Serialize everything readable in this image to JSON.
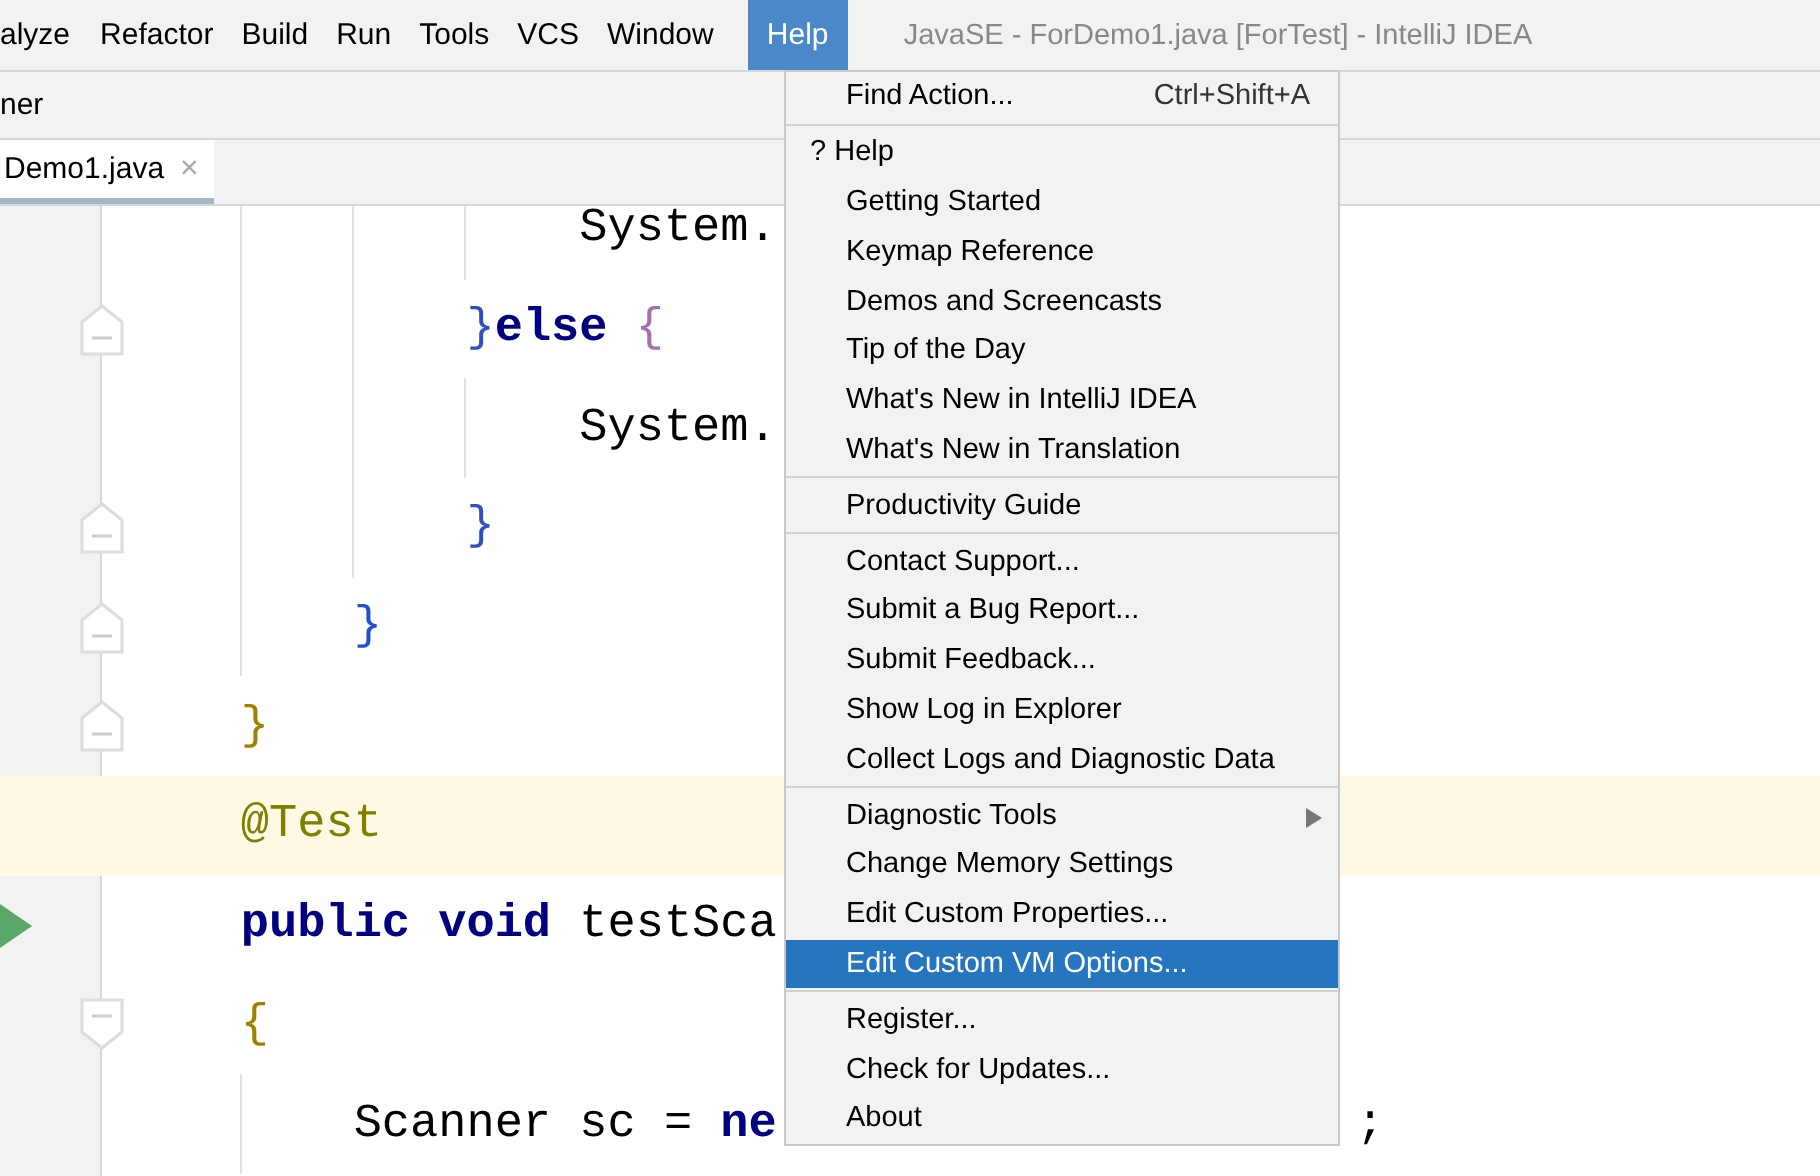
{
  "menu_bar": [
    {
      "label": "alyze",
      "selected": false
    },
    {
      "label": "Refactor",
      "selected": false
    },
    {
      "label": "Build",
      "selected": false
    },
    {
      "label": "Run",
      "selected": false
    },
    {
      "label": "Tools",
      "selected": false
    },
    {
      "label": "VCS",
      "selected": false
    },
    {
      "label": "Window",
      "selected": false
    },
    {
      "label": "Help",
      "selected": true
    }
  ],
  "window": {
    "title": "JavaSE - ForDemo1.java [ForTest] - IntelliJ IDEA"
  },
  "toolbar": {
    "text": "ner"
  },
  "tabs": [
    {
      "label": "Demo1.java",
      "close": "×",
      "selected": true
    }
  ],
  "editor": {
    "lines": [
      {
        "tokens": [
          {
            "kind": "plain",
            "text": "                System."
          }
        ]
      },
      {
        "fold_end": true,
        "tokens": [
          {
            "kind": "brace",
            "text": "            }",
            "color": "#3050c0"
          },
          {
            "kind": "keyword",
            "text": "else"
          },
          {
            "kind": "brace",
            "text": " {",
            "color": "#a070b0"
          }
        ]
      },
      {
        "tokens": [
          {
            "kind": "plain",
            "text": "                System."
          }
        ]
      },
      {
        "fold_end": true,
        "tokens": [
          {
            "kind": "brace",
            "text": "            }",
            "color": "#3050c0"
          }
        ]
      },
      {
        "fold_end": true,
        "tokens": [
          {
            "kind": "brace",
            "text": "        }",
            "color": "#2050d0"
          }
        ]
      },
      {
        "fold_end": true,
        "tokens": [
          {
            "kind": "brace",
            "text": "    }",
            "color": "#a08000"
          }
        ]
      },
      {
        "highlighted": true,
        "tokens": [
          {
            "kind": "annotation",
            "text": "    @Test"
          }
        ]
      },
      {
        "run": true,
        "tokens": [
          {
            "kind": "keyword",
            "text": "    public void"
          },
          {
            "kind": "plain",
            "text": " testSca"
          }
        ]
      },
      {
        "fold_start": true,
        "tokens": [
          {
            "kind": "brace",
            "text": "    {",
            "color": "#a08000"
          }
        ]
      },
      {
        "tokens": [
          {
            "kind": "plain",
            "text": "        Scanner sc = "
          },
          {
            "kind": "keyword",
            "text": "ne"
          }
        ],
        "tail": ";"
      }
    ]
  },
  "help_menu": {
    "groups": [
      [
        {
          "label": "Find Action...",
          "shortcut": "Ctrl+Shift+A",
          "selected": false
        }
      ],
      [
        {
          "label": "? Help",
          "selected": false
        },
        {
          "label": "Getting Started",
          "selected": false
        },
        {
          "label": "Keymap Reference",
          "selected": false
        },
        {
          "label": "Demos and Screencasts",
          "selected": false
        },
        {
          "label": "Tip of the Day",
          "selected": false
        },
        {
          "label": "What's New in IntelliJ IDEA",
          "selected": false
        },
        {
          "label": "What's New in Translation",
          "selected": false
        }
      ],
      [
        {
          "label": "Productivity Guide",
          "selected": false
        }
      ],
      [
        {
          "label": "Contact Support...",
          "selected": false
        },
        {
          "label": "Submit a Bug Report...",
          "selected": false
        },
        {
          "label": "Submit Feedback...",
          "selected": false
        },
        {
          "label": "Show Log in Explorer",
          "selected": false
        },
        {
          "label": "Collect Logs and Diagnostic Data",
          "selected": false
        }
      ],
      [
        {
          "label": "Diagnostic Tools",
          "submenu": true,
          "selected": false
        },
        {
          "label": "Change Memory Settings",
          "selected": false
        },
        {
          "label": "Edit Custom Properties...",
          "selected": false
        },
        {
          "label": "Edit Custom VM Options...",
          "selected": true
        }
      ],
      [
        {
          "label": "Register...",
          "selected": false
        },
        {
          "label": "Check for Updates...",
          "selected": false
        },
        {
          "label": "About",
          "selected": false
        }
      ]
    ]
  }
}
